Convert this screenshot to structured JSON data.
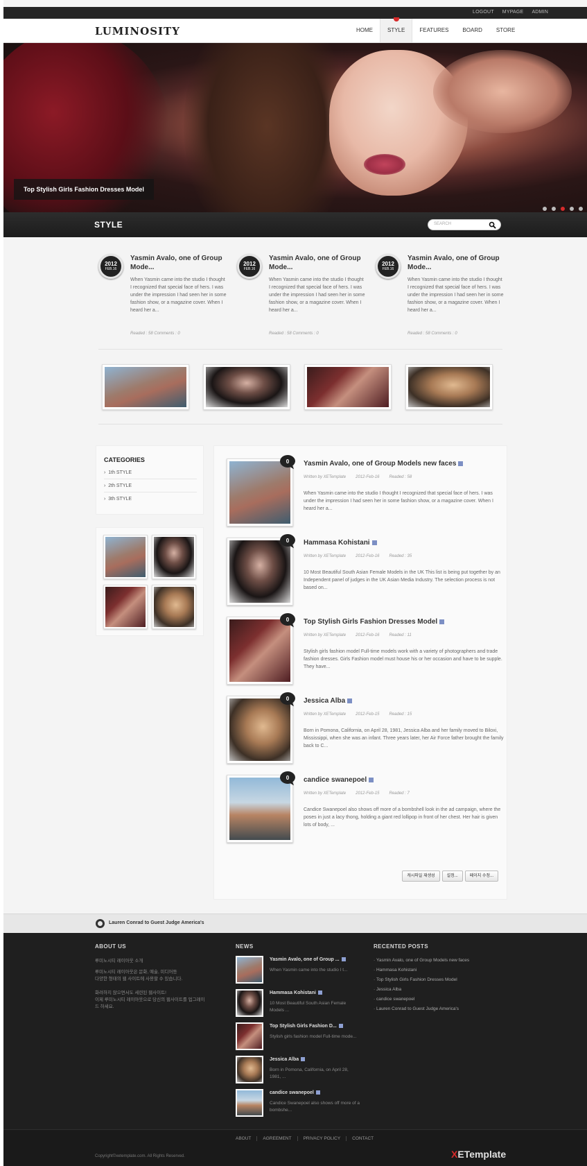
{
  "util_links": [
    "LOGOUT",
    "MYPAGE",
    "ADMIN"
  ],
  "logo": "LUMINOSITY",
  "nav": [
    {
      "label": "HOME",
      "active": false
    },
    {
      "label": "STYLE",
      "active": true
    },
    {
      "label": "FEATURES",
      "active": false
    },
    {
      "label": "BOARD",
      "active": false
    },
    {
      "label": "STORE",
      "active": false
    }
  ],
  "hero": {
    "caption": "Top Stylish Girls Fashion Dresses Model",
    "slide_count": 5,
    "active_slide": 3
  },
  "section": {
    "title": "STYLE",
    "search_placeholder": "SEARCH"
  },
  "featured": [
    {
      "year": "2012",
      "day": "FEB.16",
      "title": "Yasmin Avalo, one of Group Mode...",
      "excerpt": "When Yasmin came into the studio I thought I recognized that special face of hers. I was under the impression I had seen her in some fashion show, or a magazine cover. When I heard her a...",
      "meta": "Readed : 58    Comments : 0"
    },
    {
      "year": "2012",
      "day": "FEB.16",
      "title": "Yasmin Avalo, one of Group Mode...",
      "excerpt": "When Yasmin came into the studio I thought I recognized that special face of hers. I was under the impression I had seen her in some fashion show, or a magazine cover. When I heard her a...",
      "meta": "Readed : 58    Comments : 0"
    },
    {
      "year": "2012",
      "day": "FEB.16",
      "title": "Yasmin Avalo, one of Group Mode...",
      "excerpt": "When Yasmin came into the studio I thought I recognized that special face of hers. I was under the impression I had seen her in some fashion show, or a magazine cover. When I heard her a...",
      "meta": "Readed : 58    Comments : 0"
    }
  ],
  "categories": {
    "heading": "CATEGORIES",
    "items": [
      "1th STYLE",
      "2th STYLE",
      "3th STYLE"
    ]
  },
  "posts": [
    {
      "title": "Yasmin Avalo, one of Group Models new faces",
      "author": "Written by XETemplate",
      "date": "2012-Feb-16",
      "readed": "Readed : 58",
      "excerpt": "When Yasmin came into the studio I thought I recognized that special face of hers. I was under the impression I had seen her in some fashion show, or a magazine cover. When I heard her a..."
    },
    {
      "title": "Hammasa Kohistani",
      "author": "Written by XETemplate",
      "date": "2012-Feb-16",
      "readed": "Readed : 35",
      "excerpt": "10 Most Beautiful South Asian Female Models in the UK This list is being put together by an Independent panel of judges in the UK Asian Media Industry. The selection process is not based on..."
    },
    {
      "title": "Top Stylish Girls Fashion Dresses Model",
      "author": "Written by XETemplate",
      "date": "2012-Feb-16",
      "readed": "Readed : 11",
      "excerpt": "Stylish girls fashion model Full-time models work with a variety of photographers and trade fashion dresses. Girls Fashion model must house his or her occasion and have to be supple. They have..."
    },
    {
      "title": "Jessica Alba",
      "author": "Written by XETemplate",
      "date": "2012-Feb-15",
      "readed": "Readed : 15",
      "excerpt": "Born in Pomona, California, on April 28, 1981, Jessica Alba and her family moved to Biloxi, Mississippi, when she was an infant. Three years later, her Air Force father brought the family back to C..."
    },
    {
      "title": "candice swanepoel",
      "author": "Written by XETemplate",
      "date": "2012-Feb-15",
      "readed": "Readed : 7",
      "excerpt": "Candice Swanepoel also shows off more of a bombshell look in the ad campaign, where the poses in just a lacy thong, holding a giant red lollipop in front of her chest. Her hair is given lots of body, ..."
    }
  ],
  "admin_buttons": [
    "캐시파일 재생성",
    "설정...",
    "페이지 수정..."
  ],
  "ticker": "Lauren Conrad to Guest Judge America's",
  "footer": {
    "about_heading": "ABOUT US",
    "about_lines": [
      "루미노시티 레이아웃 소개",
      "루미노시티 레이아웃은 문화, 예술, 미디어등",
      "다양한 형태의 웹 사이트에 사용할 수 있습니다.",
      "화려하지 않으면서도 세련된 웹사이트!",
      "이제 루미노시티 레이아웃으로 당신의 웹사이트를 업그레이",
      "드 하세요."
    ],
    "news_heading": "NEWS",
    "news": [
      {
        "title": "Yasmin Avalo, one of Group ...",
        "excerpt": "When Yasmin came into the studio I t..."
      },
      {
        "title": "Hammasa Kohistani",
        "excerpt": "10 Most Beautiful South Asian Female Models ..."
      },
      {
        "title": "Top Stylish Girls Fashion D...",
        "excerpt": "Stylish girls fashion model Full-time mode..."
      },
      {
        "title": "Jessica Alba",
        "excerpt": "Born in Pomona, California, on April 28, 1981, ..."
      },
      {
        "title": "candice swanepoel",
        "excerpt": "Candice Swanepoel also shows off more of a bombshe..."
      }
    ],
    "recent_heading": "RECENTED POSTS",
    "recent": [
      "Yasmin Avalo, one of Group Models new faces",
      "Hammasa Kohistani",
      "Top Stylish Girls Fashion Dresses Model",
      "Jessica Alba",
      "candice swanepoel",
      "Lauren Conrad to Guest Judge America's"
    ],
    "links": [
      "ABOUT",
      "AGREEMENT",
      "PRIVACY POLICY",
      "CONTACT"
    ],
    "copyright": "Copyright©xetemplate.com. All Rights Reserved.",
    "brand_x": "X",
    "brand_rest": "ETemplate"
  },
  "colors": {
    "accent": "#d62b2b",
    "dark": "#1f1f1f"
  }
}
